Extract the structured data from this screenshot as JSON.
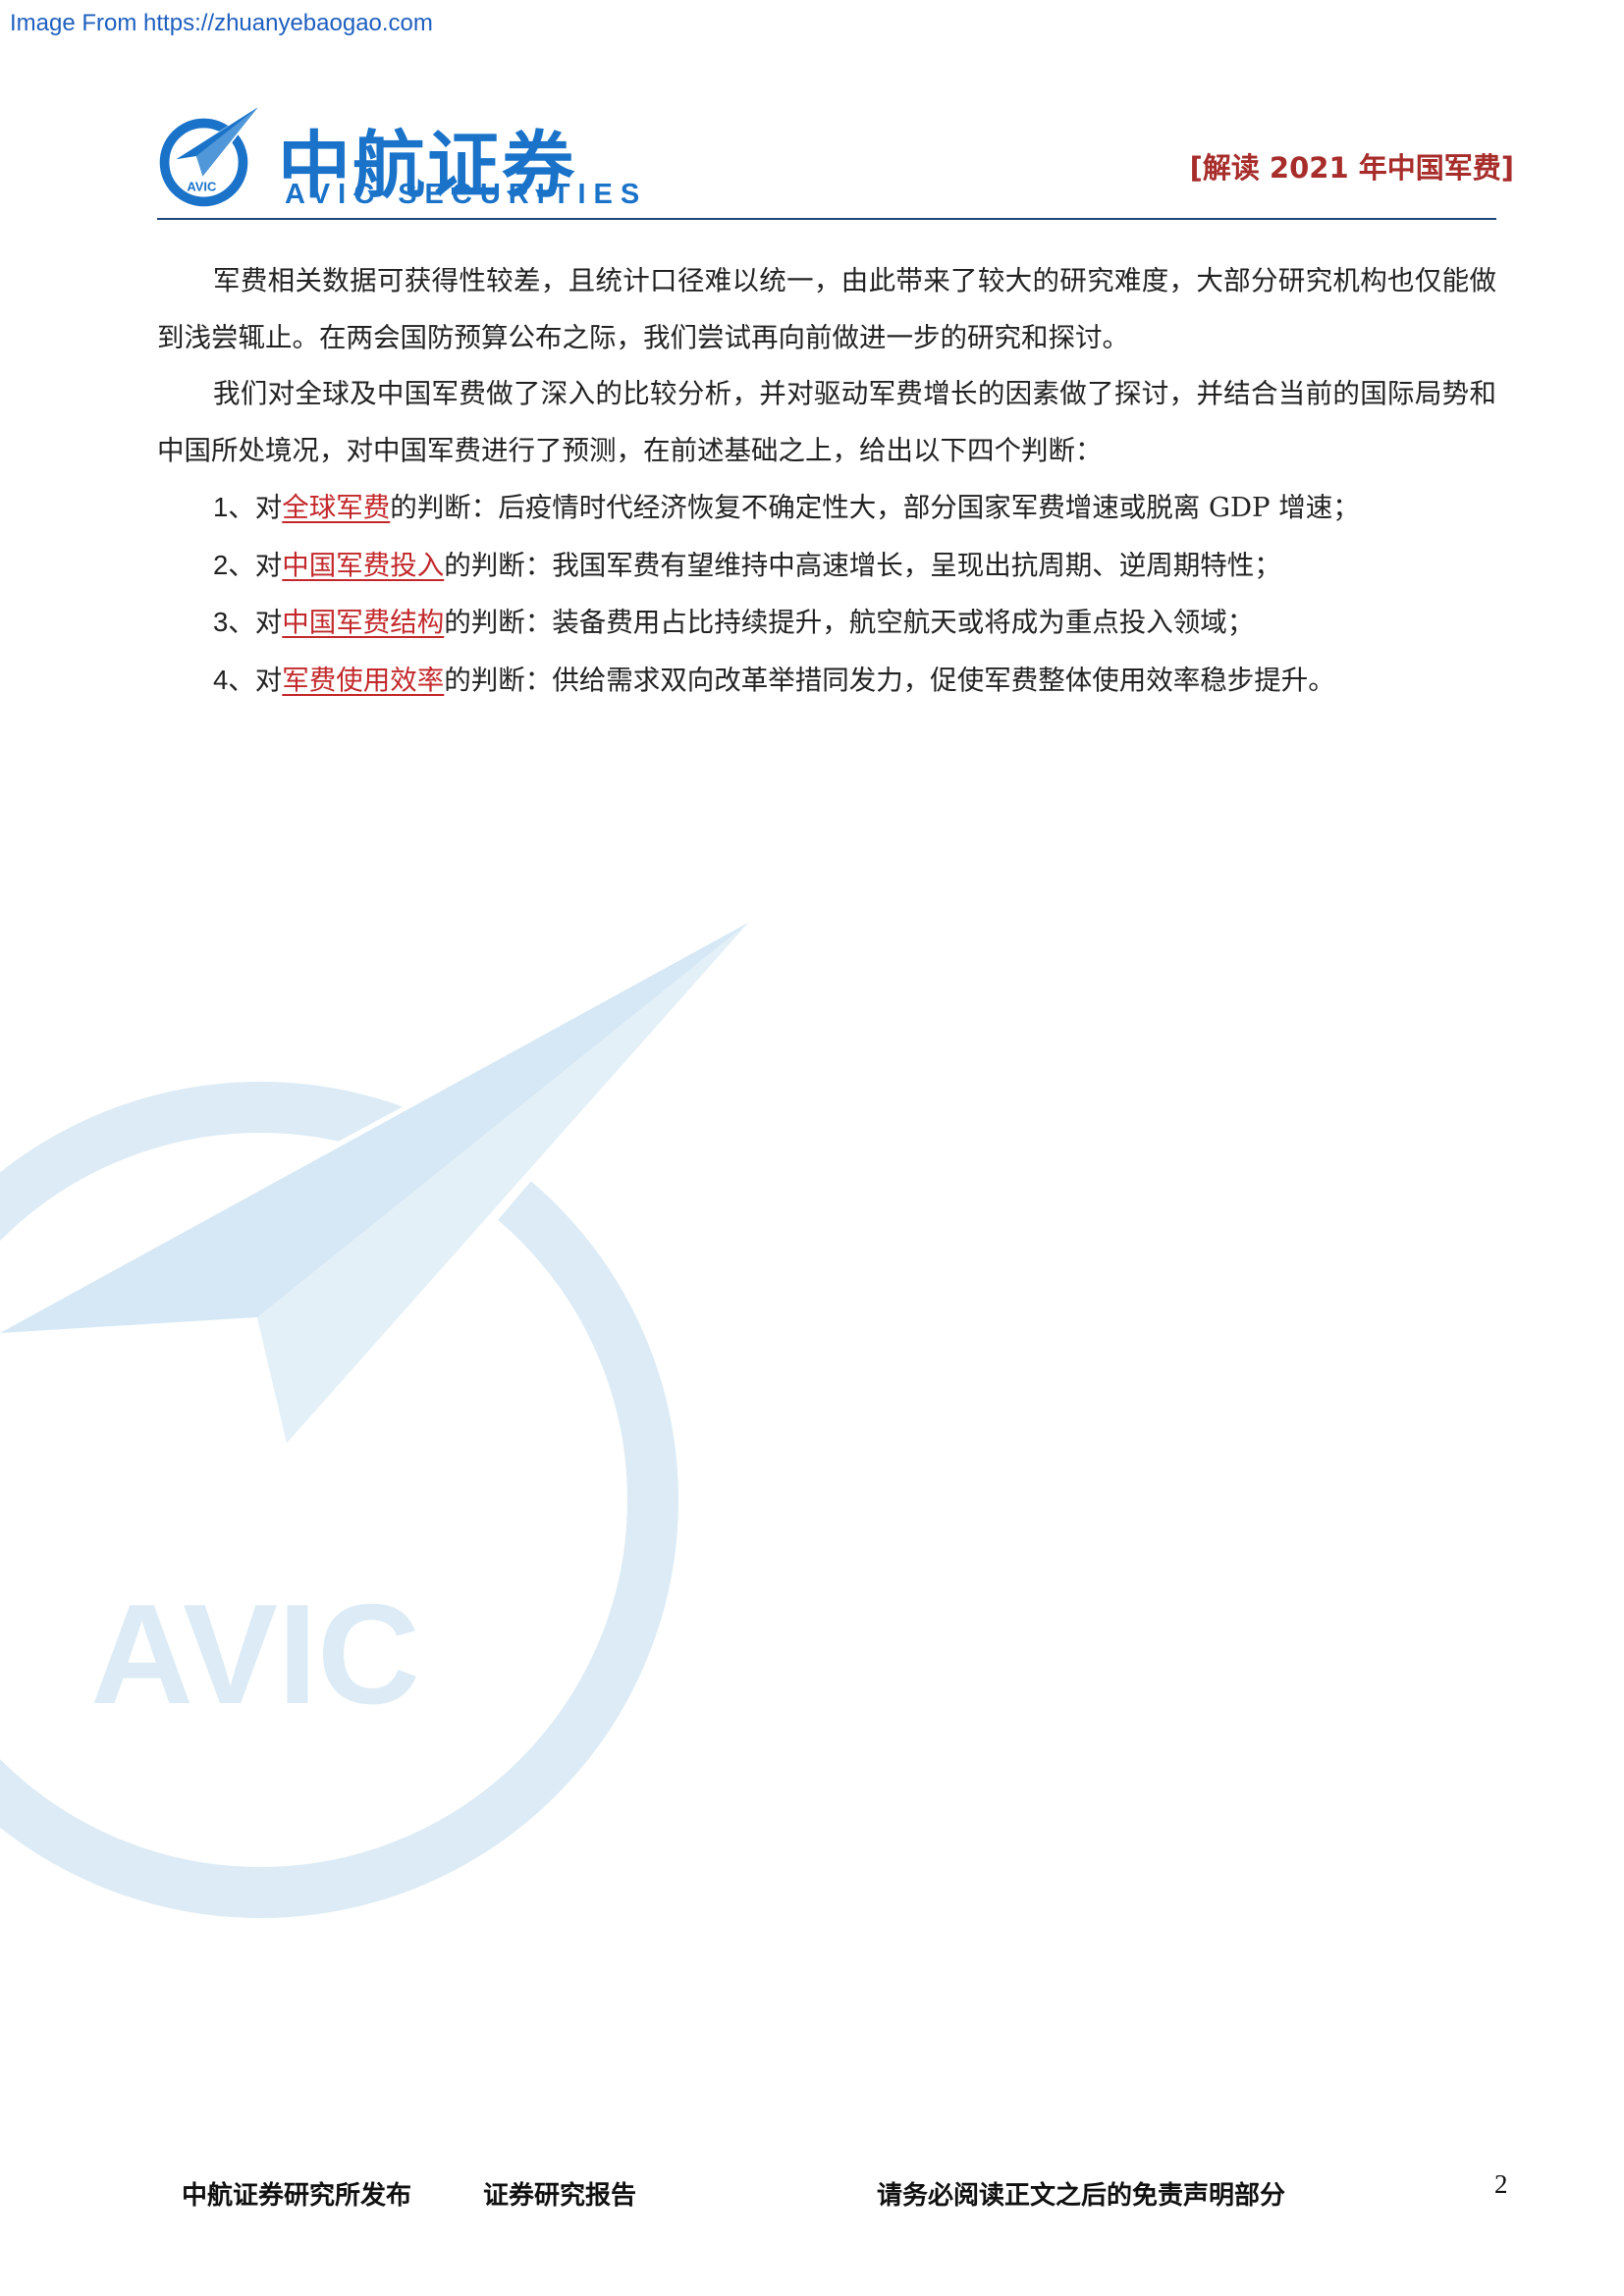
{
  "source_banner": "Image From https://zhuanyebaogao.com",
  "header": {
    "logo_badge": "AVIC",
    "brand_cn": "中航证券",
    "brand_en": "AVIC SECURITIES",
    "report_tag": "[解读 2021 年中国军费]"
  },
  "body": {
    "paragraphs": [
      "军费相关数据可获得性较差，且统计口径难以统一，由此带来了较大的研究难度，大部分研究机构也仅能做到浅尝辄止。在两会国防预算公布之际，我们尝试再向前做进一步的研究和探讨。",
      "我们对全球及中国军费做了深入的比较分析，并对驱动军费增长的因素做了探讨，并结合当前的国际局势和中国所处境况，对中国军费进行了预测，在前述基础之上，给出以下四个判断："
    ],
    "judgments": [
      {
        "num": "1、",
        "prefix": "对",
        "highlight": "全球军费",
        "suffix": "的判断：后疫情时代经济恢复不确定性大，部分国家军费增速或脱离 GDP 增速；"
      },
      {
        "num": "2、",
        "prefix": "对",
        "highlight": "中国军费投入",
        "suffix": "的判断：我国军费有望维持中高速增长，呈现出抗周期、逆周期特性；"
      },
      {
        "num": "3、",
        "prefix": "对",
        "highlight": "中国军费结构",
        "suffix": "的判断：装备费用占比持续提升，航空航天或将成为重点投入领域；"
      },
      {
        "num": "4、",
        "prefix": "对",
        "highlight": "军费使用效率",
        "suffix": "的判断：供给需求双向改革举措同发力，促使军费整体使用效率稳步提升。"
      }
    ]
  },
  "watermark_text": "AVIC",
  "footer": {
    "publisher": "中航证券研究所发布",
    "report_type": "证券研究报告",
    "disclaimer": "请务必阅读正文之后的免责声明部分",
    "page_number": "2"
  },
  "colors": {
    "brand_blue": "#1a73c9",
    "tag_red": "#a72d2b",
    "highlight_red": "#c3282b",
    "watermark_blue": "#dcebf5"
  }
}
